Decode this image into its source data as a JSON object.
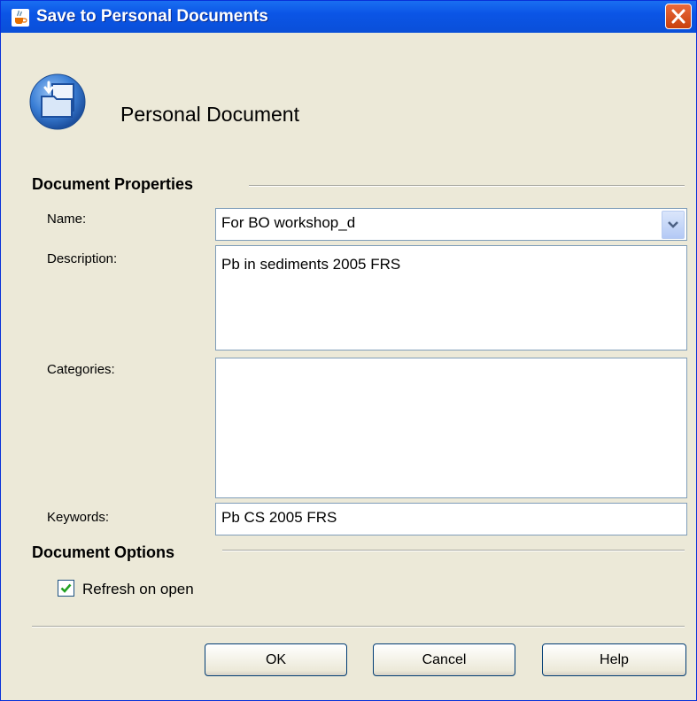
{
  "window": {
    "title": "Save to Personal Documents"
  },
  "header": {
    "title": "Personal Document"
  },
  "properties": {
    "section_label": "Document Properties",
    "name_label": "Name:",
    "name_value": "For BO workshop_d",
    "description_label": "Description:",
    "description_value": "Pb in sediments 2005 FRS",
    "categories_label": "Categories:",
    "categories_value": "",
    "keywords_label": "Keywords:",
    "keywords_value": "Pb CS 2005 FRS"
  },
  "options": {
    "section_label": "Document Options",
    "refresh_label": "Refresh on open",
    "refresh_checked": true
  },
  "buttons": {
    "ok": "OK",
    "cancel": "Cancel",
    "help": "Help"
  },
  "colors": {
    "titlebar": "#0b55e6",
    "close": "#d6521f",
    "field_border": "#7f9db9",
    "dialog_bg": "#ece9d8"
  }
}
